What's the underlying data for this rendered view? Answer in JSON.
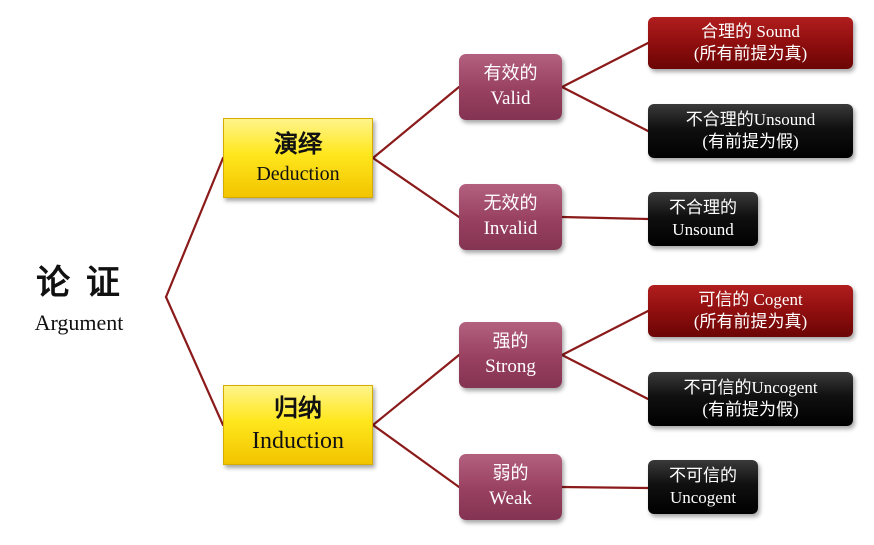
{
  "colors": {
    "connector": "#8b1a1a",
    "deduction_box": "#ffe71d",
    "validity_box": "#98405f",
    "sound_box": "#8c0d0d",
    "unsound_box": "#101010"
  },
  "root": {
    "zh": "论 证",
    "en": "Argument"
  },
  "deduction": {
    "zh": "演绎",
    "en": "Deduction"
  },
  "induction": {
    "zh": "归纳",
    "en": "Induction"
  },
  "valid": {
    "zh": "有效的",
    "en": "Valid"
  },
  "invalid": {
    "zh": "无效的",
    "en": "Invalid"
  },
  "strong": {
    "zh": "强的",
    "en": "Strong"
  },
  "weak": {
    "zh": "弱的",
    "en": "Weak"
  },
  "sound": {
    "line1": "合理的 Sound",
    "line2": "(所有前提为真)"
  },
  "unsound_valid": {
    "line1": "不合理的Unsound",
    "line2": "(有前提为假)"
  },
  "unsound_invalid": {
    "line1": "不合理的",
    "line2": "Unsound"
  },
  "cogent": {
    "line1": "可信的 Cogent",
    "line2": "(所有前提为真)"
  },
  "uncogent_strong": {
    "line1": "不可信的Uncogent",
    "line2": "(有前提为假)"
  },
  "uncogent_weak": {
    "line1": "不可信的",
    "line2": "Uncogent"
  }
}
